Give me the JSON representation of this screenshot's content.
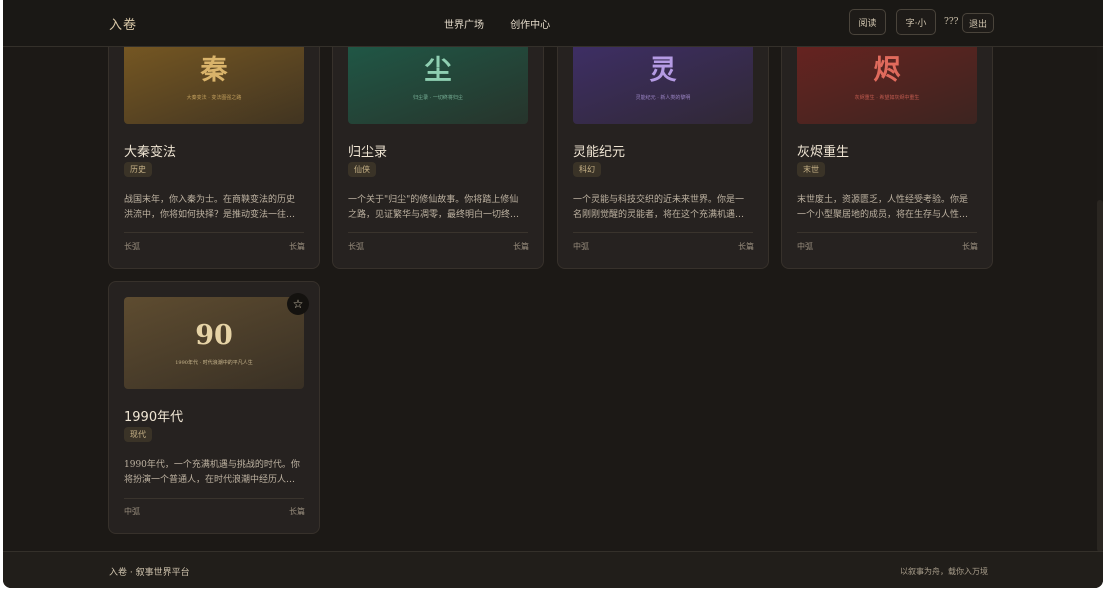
{
  "header": {
    "logo": "入卷",
    "nav": [
      "世界广场",
      "创作中心"
    ],
    "read_btn": "阅读",
    "font_btn": "字·小",
    "user": "???",
    "logout_btn": "退出"
  },
  "cards": [
    {
      "cover_glyph": "秦",
      "cover_sub": "大秦变法 · 变法图强之路",
      "title": "大秦变法",
      "tag": "历史",
      "desc": [
        "战国末年，你入秦为士。在商鞅变法的历史",
        "洪流中，你将如何抉择？是推动变法一往…"
      ],
      "length": "长弧",
      "type": "长篇",
      "bg": "#7a5a23",
      "glyph_color": "#d9b36a"
    },
    {
      "cover_glyph": "尘",
      "cover_sub": "归尘录 · 一切终将归尘",
      "title": "归尘录",
      "tag": "仙侠",
      "desc": [
        "一个关于\"归尘\"的修仙故事。你将踏上修仙",
        "之路，见证繁华与凋零，最终明白一切终…"
      ],
      "length": "长弧",
      "type": "长篇",
      "bg": "#1f5a48",
      "glyph_color": "#8fcfb2"
    },
    {
      "cover_glyph": "灵",
      "cover_sub": "灵能纪元 · 新人类的黎明",
      "title": "灵能纪元",
      "tag": "科幻",
      "desc": [
        "一个灵能与科技交织的近未来世界。你是一",
        "名刚刚觉醒的灵能者，将在这个充满机遇…"
      ],
      "length": "中弧",
      "type": "长篇",
      "bg": "#3f2f69",
      "glyph_color": "#b59be4"
    },
    {
      "cover_glyph": "烬",
      "cover_sub": "灰烬重生 · 希望如灰烬中重生",
      "title": "灰烬重生",
      "tag": "末世",
      "desc": [
        "末世废土，资源匮乏，人性经受考验。你是",
        "一个小型聚居地的成员，将在生存与人性…"
      ],
      "length": "中弧",
      "type": "长篇",
      "bg": "#6a2320",
      "glyph_color": "#e06a5c"
    },
    {
      "cover_glyph": "90",
      "cover_sub": "1990年代 · 时代浪潮中的平凡人生",
      "title": "1990年代",
      "tag": "现代",
      "desc": [
        "1990年代，一个充满机遇与挑战的时代。你",
        "将扮演一个普通人，在时代浪潮中经历人…"
      ],
      "length": "中弧",
      "type": "长篇",
      "bg": "#5e4c30",
      "glyph_color": "#e6d3a6"
    }
  ],
  "footer": {
    "left": "入卷 · 叙事世界平台",
    "right": "以叙事为舟，载你入万境"
  }
}
